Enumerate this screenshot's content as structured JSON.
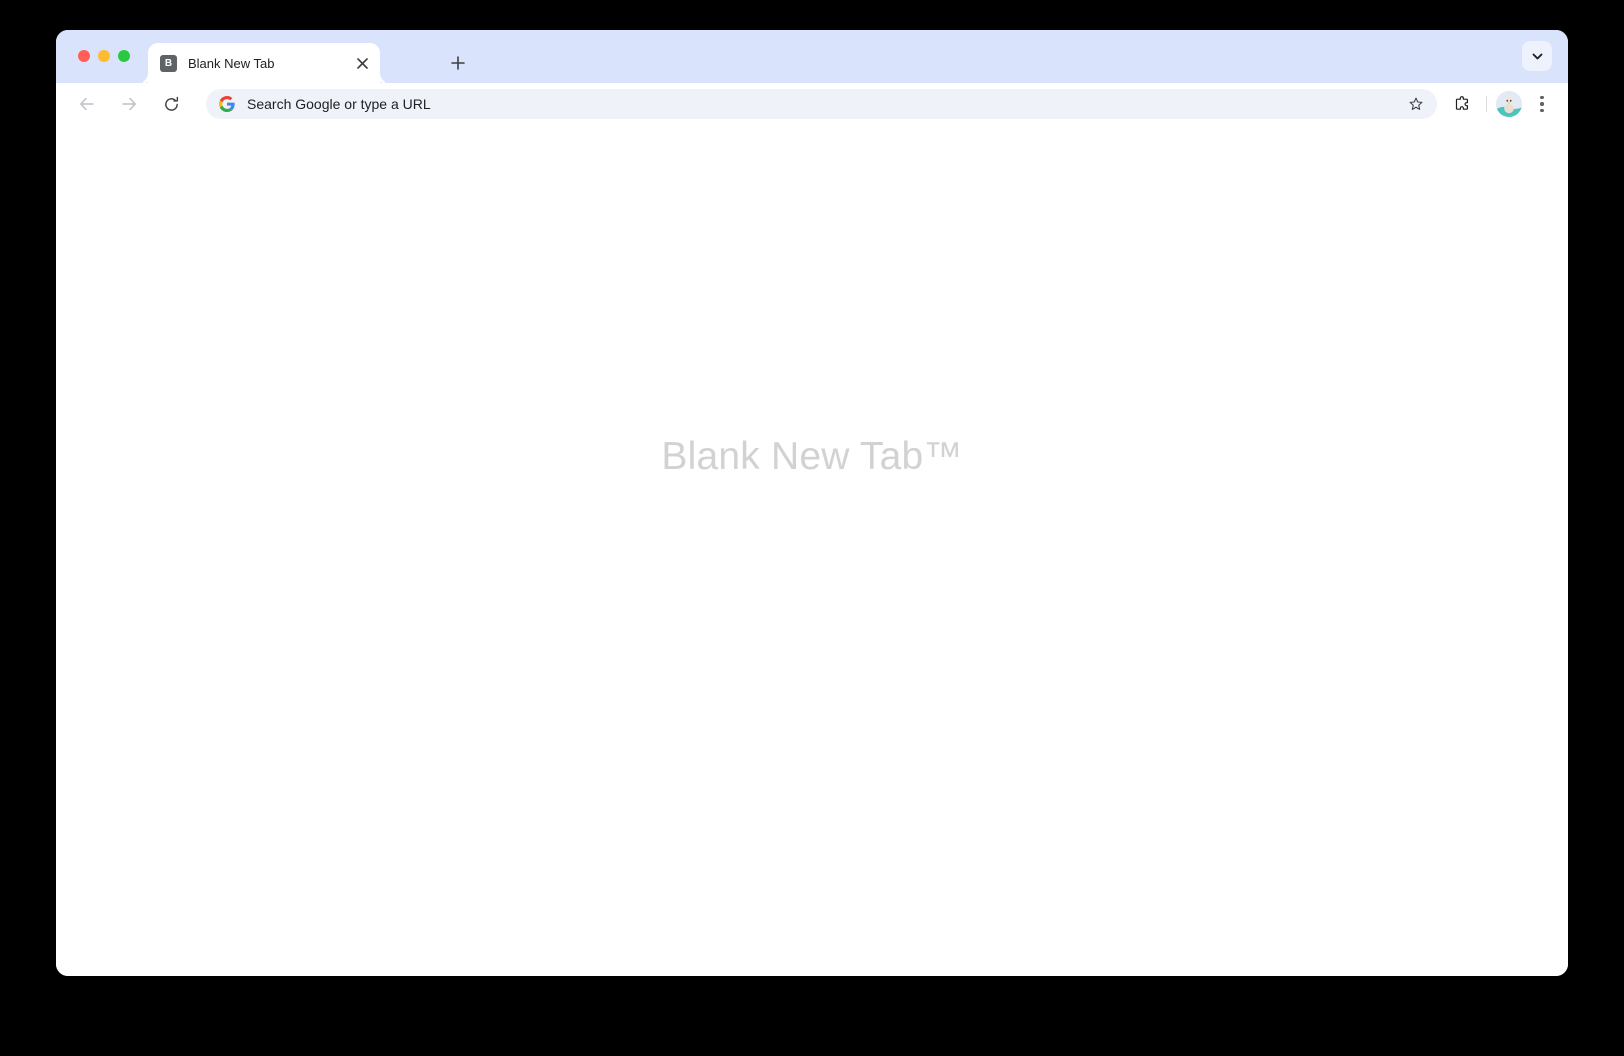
{
  "window": {
    "traffic_lights": [
      {
        "name": "close",
        "color": "#ff5f57"
      },
      {
        "name": "minimize",
        "color": "#febc2e"
      },
      {
        "name": "maximize",
        "color": "#28c840"
      }
    ]
  },
  "tabstrip": {
    "background_color": "#d9e3fb",
    "tabs": [
      {
        "title": "Blank New Tab",
        "favicon_letter": "B",
        "favicon_bg": "#5f6368",
        "active": true,
        "close_label": "✕"
      }
    ],
    "new_tab_icon": "plus-icon",
    "tab_search_icon": "chevron-down-icon"
  },
  "toolbar": {
    "back_icon": "arrow-left-icon",
    "forward_icon": "arrow-right-icon",
    "reload_icon": "reload-icon",
    "omnibox": {
      "placeholder": "Search Google or type a URL",
      "value": "",
      "leading_icon": "google-g-icon",
      "bookmark_icon": "star-icon",
      "background_color": "#eff2f9"
    },
    "extensions_icon": "puzzle-piece-icon",
    "profile_icon": "avatar-cat-icon",
    "menu_icon": "kebab-menu-icon"
  },
  "page": {
    "watermark": "Blank New Tab™",
    "watermark_color": "#d2d2d2",
    "background_color": "#ffffff"
  }
}
